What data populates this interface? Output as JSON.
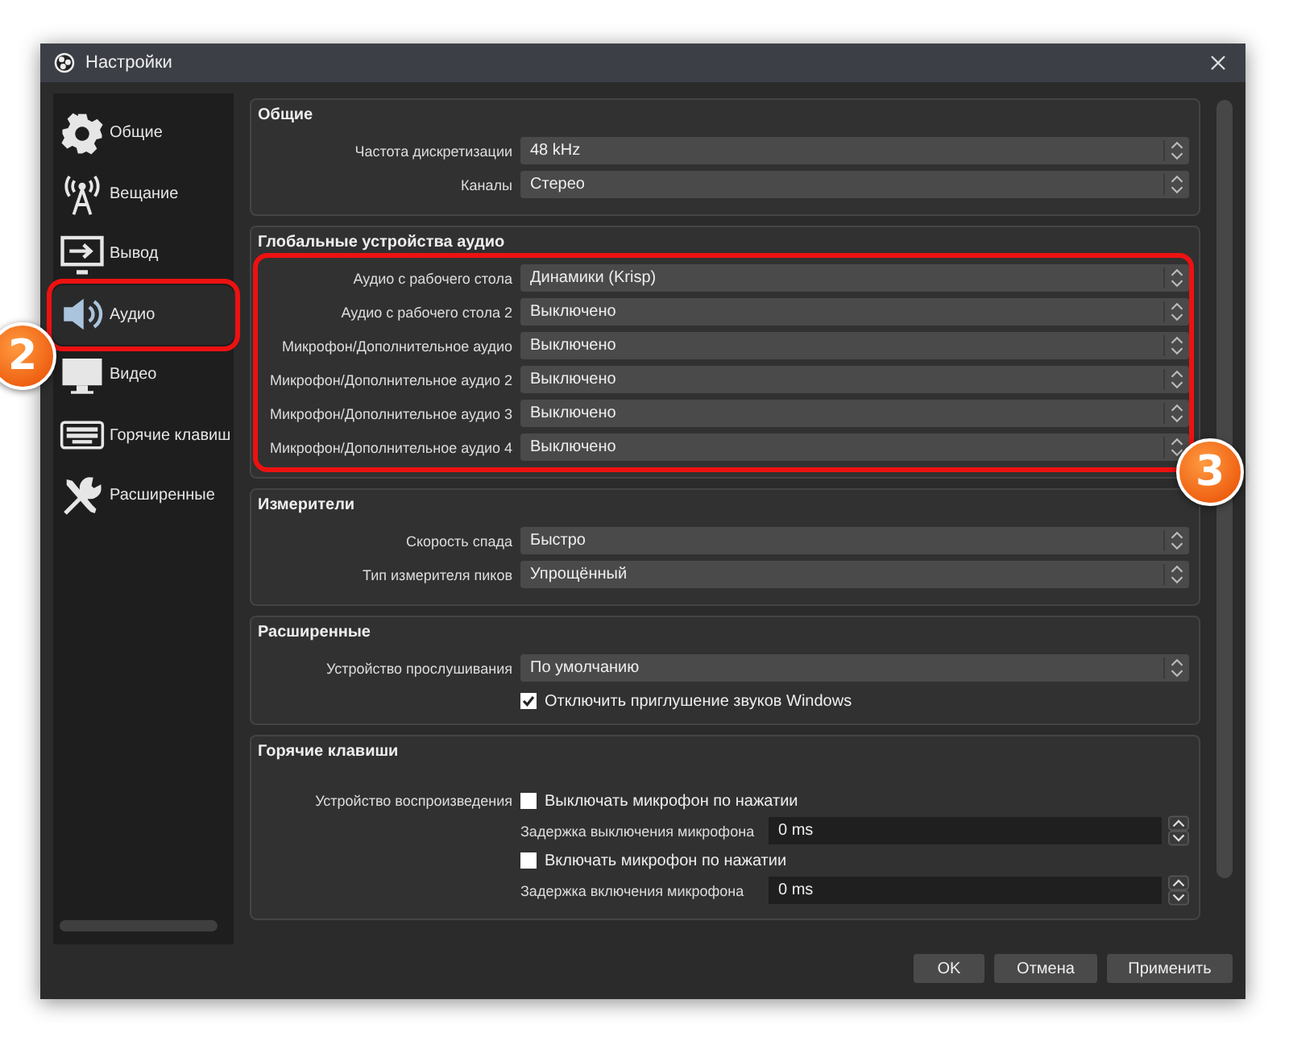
{
  "window": {
    "title": "Настройки"
  },
  "sidebar": {
    "items": [
      {
        "kind": "gear",
        "label": "Общие",
        "selected": false,
        "highlighted": false
      },
      {
        "kind": "tower",
        "label": "Вещание",
        "selected": false,
        "highlighted": false
      },
      {
        "kind": "output",
        "label": "Вывод",
        "selected": false,
        "highlighted": false
      },
      {
        "kind": "speaker",
        "label": "Аудио",
        "selected": true,
        "highlighted": true,
        "callout": "2"
      },
      {
        "kind": "monitor",
        "label": "Видео",
        "selected": false,
        "highlighted": false
      },
      {
        "kind": "keyboard",
        "label": "Горячие клавиш",
        "selected": false,
        "highlighted": false
      },
      {
        "kind": "tools",
        "label": "Расширенные",
        "selected": false,
        "highlighted": false
      }
    ]
  },
  "sections": [
    {
      "title": "Общие",
      "highlighted": false,
      "rows": [
        {
          "label": "Частота дискретизации",
          "value": "48 kHz"
        },
        {
          "label": "Каналы",
          "value": "Стерео"
        }
      ]
    },
    {
      "title": "Глобальные устройства аудио",
      "highlighted": true,
      "callout": "3",
      "rows": [
        {
          "label": "Аудио с рабочего стола",
          "value": "Динамики (Krisp)"
        },
        {
          "label": "Аудио с рабочего стола 2",
          "value": "Выключено"
        },
        {
          "label": "Микрофон/Дополнительное аудио",
          "value": "Выключено"
        },
        {
          "label": "Микрофон/Дополнительное аудио 2",
          "value": "Выключено"
        },
        {
          "label": "Микрофон/Дополнительное аудио 3",
          "value": "Выключено"
        },
        {
          "label": "Микрофон/Дополнительное аудио 4",
          "value": "Выключено"
        }
      ]
    },
    {
      "title": "Измерители",
      "highlighted": false,
      "rows": [
        {
          "label": "Скорость спада",
          "value": "Быстро"
        },
        {
          "label": "Тип измерителя пиков",
          "value": "Упрощённый"
        }
      ]
    },
    {
      "title": "Расширенные",
      "highlighted": false,
      "rows": [
        {
          "label": "Устройство прослушивания",
          "value": "По умолчанию"
        }
      ],
      "checkbox": {
        "label": "Отключить приглушение звуков Windows",
        "checked": true
      }
    }
  ],
  "hotkeys": {
    "title": "Горячие клавиши",
    "device_label": "Устройство воспроизведения",
    "items": [
      {
        "kind": "checkbox",
        "label": "Выключать микрофон по нажатии",
        "checked": false
      },
      {
        "kind": "spin",
        "label": "Задержка выключения микрофона",
        "value": "0 ms"
      },
      {
        "kind": "checkbox",
        "label": "Включать микрофон по нажатии",
        "checked": false
      },
      {
        "kind": "spin",
        "label": "Задержка включения микрофона",
        "value": "0 ms"
      }
    ]
  },
  "buttons": [
    "OK",
    "Отмена",
    "Применить"
  ]
}
